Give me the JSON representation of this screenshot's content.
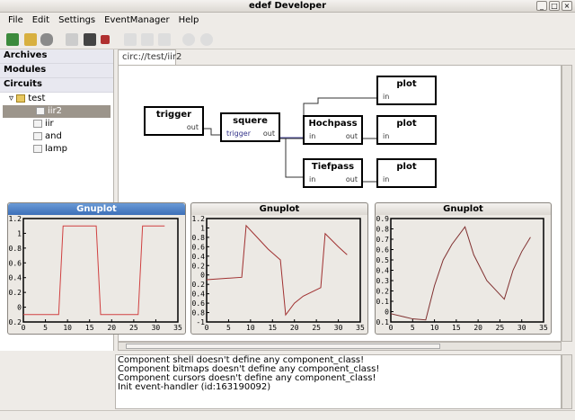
{
  "window": {
    "title": "edef Developer"
  },
  "menu": [
    "File",
    "Edit",
    "Settings",
    "EventManager",
    "Help"
  ],
  "toolbar": [
    "new-icon",
    "open-icon",
    "delete-icon",
    "save-icon",
    "save-as-icon",
    "close-icon",
    "copy-icon",
    "cut-icon",
    "paste-icon",
    "undo-icon",
    "redo-icon"
  ],
  "sidebar": {
    "archives": "Archives",
    "modules": "Modules",
    "circuits": "Circuits",
    "folder": "test",
    "items": [
      "iir2",
      "iir",
      "and",
      "lamp"
    ],
    "selected": "iir2"
  },
  "tab": {
    "label": "circ://test/iir2"
  },
  "diagram": {
    "blocks": [
      {
        "name": "trigger",
        "ports": [
          "out"
        ]
      },
      {
        "name": "squere",
        "ports": [
          "trigger",
          "out"
        ]
      },
      {
        "name": "Hochpass",
        "ports": [
          "in",
          "out"
        ]
      },
      {
        "name": "Tiefpass",
        "ports": [
          "in",
          "out"
        ]
      },
      {
        "name": "plot",
        "ports": [
          "in"
        ]
      },
      {
        "name": "plot",
        "ports": [
          "in"
        ]
      },
      {
        "name": "plot",
        "ports": [
          "in"
        ]
      }
    ]
  },
  "log": [
    "Component shell doesn't define any component_class!",
    "Component bitmaps doesn't define any component_class!",
    "Component cursors doesn't define any component_class!",
    "Init event-handler (id:163190092)"
  ],
  "chart_data": [
    {
      "type": "line",
      "title": "Gnuplot",
      "xlim": [
        0,
        35
      ],
      "ylim": [
        -0.2,
        1.2
      ],
      "xticks": [
        0,
        5,
        10,
        15,
        20,
        25,
        30,
        35
      ],
      "yticks": [
        -0.2,
        0,
        0.2,
        0.4,
        0.6,
        0.8,
        1,
        1.2
      ],
      "color": "#d04040",
      "x": [
        0,
        8,
        9,
        16.5,
        17.5,
        26,
        27,
        32
      ],
      "y": [
        -0.1,
        -0.1,
        1.1,
        1.1,
        -0.1,
        -0.1,
        1.1,
        1.1
      ]
    },
    {
      "type": "line",
      "title": "Gnuplot",
      "xlim": [
        0,
        35
      ],
      "ylim": [
        -1,
        1.2
      ],
      "xticks": [
        0,
        5,
        10,
        15,
        20,
        25,
        30,
        35
      ],
      "yticks": [
        -1,
        -0.8,
        -0.6,
        -0.4,
        -0.2,
        0,
        0.2,
        0.4,
        0.6,
        0.8,
        1,
        1.2
      ],
      "color": "#a03030",
      "x": [
        0,
        8,
        9,
        12,
        14,
        16.8,
        18,
        20,
        22,
        26,
        27,
        30,
        32
      ],
      "y": [
        -0.1,
        -0.05,
        1.05,
        0.75,
        0.55,
        0.32,
        -0.85,
        -0.6,
        -0.45,
        -0.27,
        0.88,
        0.6,
        0.43
      ]
    },
    {
      "type": "line",
      "title": "Gnuplot",
      "xlim": [
        0,
        35
      ],
      "ylim": [
        -0.1,
        0.9
      ],
      "xticks": [
        0,
        5,
        10,
        15,
        20,
        25,
        30,
        35
      ],
      "yticks": [
        -0.1,
        0,
        0.1,
        0.2,
        0.3,
        0.4,
        0.5,
        0.6,
        0.7,
        0.8,
        0.9
      ],
      "color": "#803030",
      "x": [
        0,
        3,
        5,
        8,
        10,
        12,
        14,
        17,
        19,
        22,
        26,
        28,
        30,
        32
      ],
      "y": [
        -0.02,
        -0.05,
        -0.07,
        -0.08,
        0.25,
        0.5,
        0.65,
        0.82,
        0.55,
        0.3,
        0.12,
        0.4,
        0.58,
        0.72
      ]
    }
  ]
}
